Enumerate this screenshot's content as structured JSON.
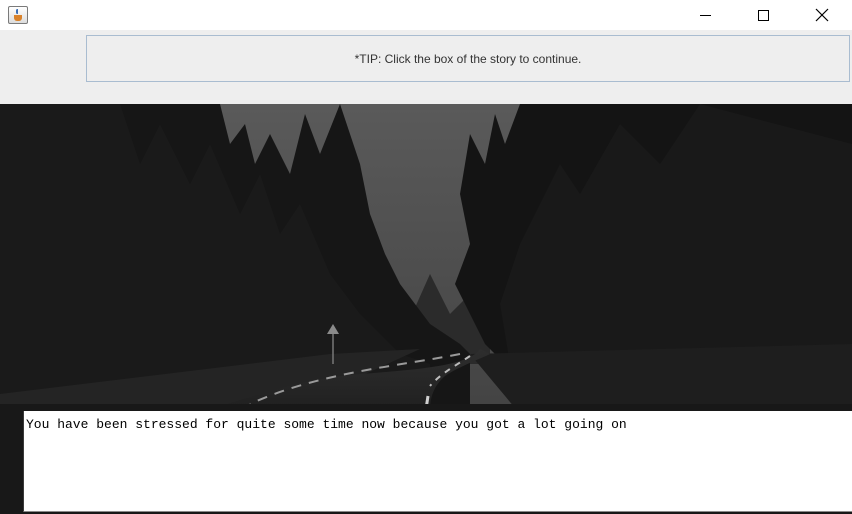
{
  "window": {
    "app_icon": "java-cup-icon",
    "controls": [
      "minimize-icon",
      "maximize-icon",
      "close-icon"
    ]
  },
  "tip": {
    "text": "*TIP: Click the box of the story to continue."
  },
  "scene": {
    "image": "dark forest road"
  },
  "story": {
    "text": "You have been stressed for quite some time now because you got a lot going on"
  },
  "colors": {
    "tip_border": "#a9bcd0",
    "panel_bg": "#eeeeee",
    "story_bg": "#ffffff"
  }
}
